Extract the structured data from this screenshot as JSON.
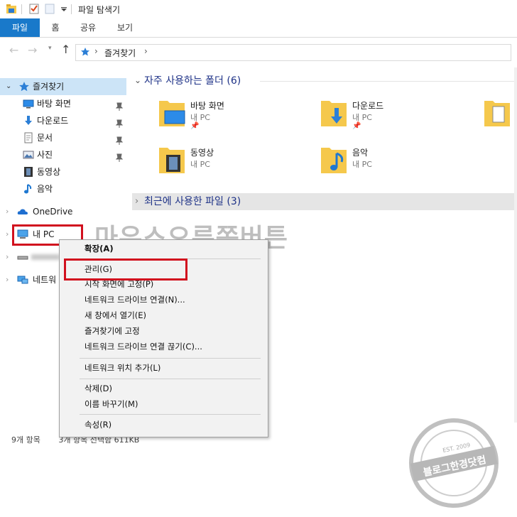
{
  "window": {
    "title": "파일 탐색기"
  },
  "ribbon": {
    "tabs": [
      "파일",
      "홈",
      "공유",
      "보기"
    ]
  },
  "address": {
    "path": "즐겨찾기",
    "sep": "›"
  },
  "nav": {
    "quick_access": "즐겨찾기",
    "items": [
      "바탕 화면",
      "다운로드",
      "문서",
      "사진",
      "동영상",
      "음악"
    ],
    "onedrive": "OneDrive",
    "mypc": "내 PC",
    "network": "네트워"
  },
  "content": {
    "frequent_header": "자주 사용하는 폴더 (6)",
    "recent_header": "최근에 사용한 파일 (3)",
    "folders": [
      {
        "name": "바탕 화면",
        "sub": "내 PC",
        "icon": "desktop-folder-icon"
      },
      {
        "name": "다운로드",
        "sub": "내 PC",
        "icon": "downloads-folder-icon"
      },
      {
        "name": "동영상",
        "sub": "내 PC",
        "icon": "videos-folder-icon"
      },
      {
        "name": "음악",
        "sub": "내 PC",
        "icon": "music-folder-icon"
      }
    ]
  },
  "context_menu": {
    "items": [
      "확장(A)",
      "관리(G)",
      "시작 화면에 고정(P)",
      "네트워크 드라이브 연결(N)...",
      "새 창에서 열기(E)",
      "즐겨찾기에 고정",
      "네트워크 드라이브 연결 끊기(C)...",
      "네트워크 위치 추가(L)",
      "삭제(D)",
      "이름 바꾸기(M)",
      "속성(R)"
    ]
  },
  "overlay_text": "마우스오른쪽버튼",
  "status": {
    "count": "9개 항목",
    "selection": "3개 항목 선택함 611KB"
  },
  "watermark": {
    "main": "블로그한경닷컴",
    "sub": "EST. 2009"
  },
  "colors": {
    "accent": "#1979ca",
    "highlight": "#d1101e",
    "folder": "#f5c84c"
  }
}
